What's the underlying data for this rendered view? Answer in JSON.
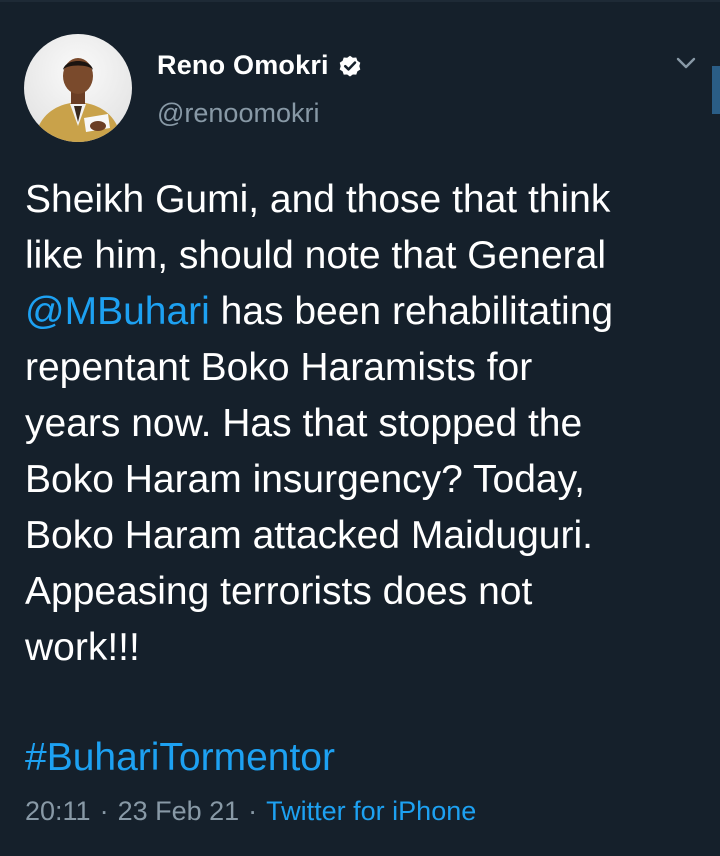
{
  "author": {
    "display_name": "Reno Omokri",
    "handle": "@renoomokri",
    "verified": true,
    "avatar_icon": "profile-photo"
  },
  "tweet": {
    "text_before_mention": "Sheikh Gumi, and those that think\nlike him, should note that General\n",
    "mention": "@MBuhari",
    "text_after_mention": " has been rehabilitating\nrepentant Boko Haramists for\nyears now. Has that stopped the\nBoko Haram insurgency? Today,\nBoko Haram attacked Maiduguri.\nAppeasing terrorists does not\nwork!!!",
    "hashtag": "#BuhariTormentor"
  },
  "meta": {
    "time": "20:11",
    "separator": "·",
    "date": "23 Feb 21",
    "source": "Twitter for iPhone"
  },
  "colors": {
    "background": "#15202b",
    "text": "#ffffff",
    "secondary_text": "#8899a6",
    "link": "#1da1f2"
  }
}
